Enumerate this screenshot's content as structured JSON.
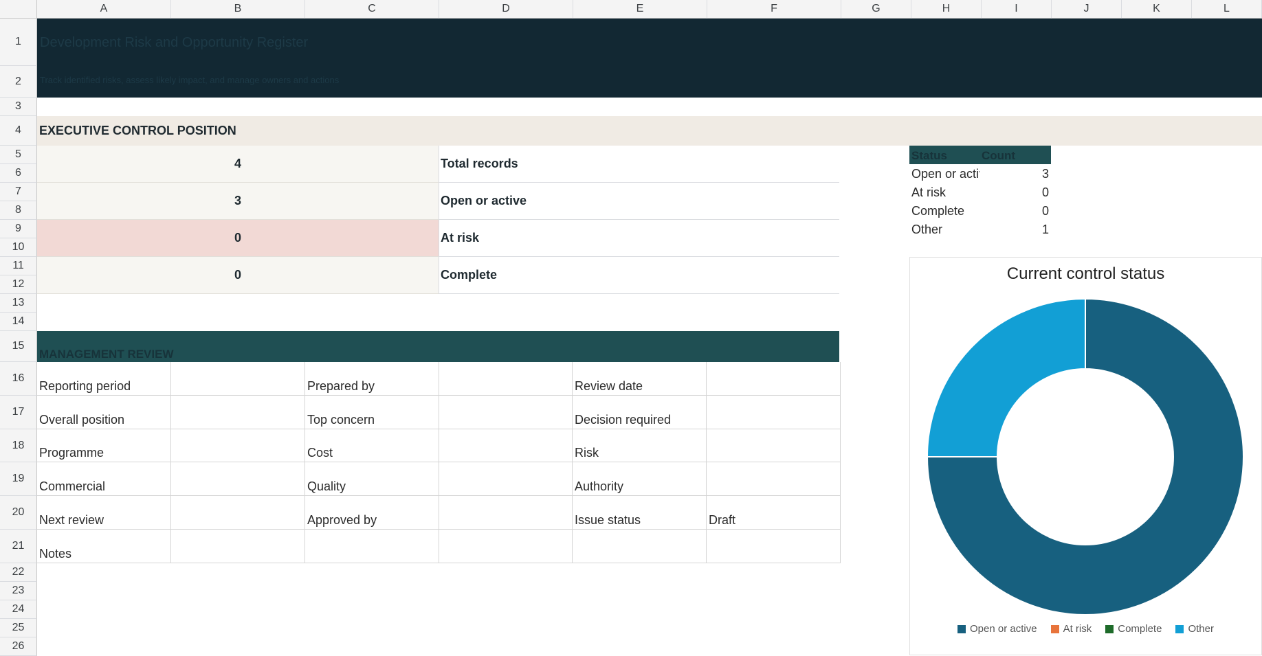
{
  "columns": [
    "A",
    "B",
    "C",
    "D",
    "E",
    "F",
    "G",
    "H",
    "I",
    "J",
    "K",
    "L"
  ],
  "rows": [
    "1",
    "2",
    "3",
    "4",
    "5",
    "6",
    "7",
    "8",
    "9",
    "10",
    "11",
    "12",
    "13",
    "14",
    "15",
    "16",
    "17",
    "18",
    "19",
    "20",
    "21",
    "22",
    "23",
    "24",
    "25",
    "26"
  ],
  "header": {
    "title": "Development Risk and Opportunity Register",
    "subtitle": "Track identified risks, assess likely impact, and manage owners and actions"
  },
  "executive": {
    "heading": "EXECUTIVE CONTROL POSITION",
    "kpis": [
      {
        "value": "4",
        "label": "Total records"
      },
      {
        "value": "3",
        "label": "Open or active"
      },
      {
        "value": "0",
        "label": "At risk"
      },
      {
        "value": "0",
        "label": "Complete"
      }
    ]
  },
  "review": {
    "heading": "MANAGEMENT REVIEW",
    "rows": [
      [
        "Reporting period",
        "",
        "Prepared by",
        "",
        "Review date",
        ""
      ],
      [
        "Overall position",
        "",
        "Top concern",
        "",
        "Decision required",
        ""
      ],
      [
        "Programme",
        "",
        "Cost",
        "",
        "Risk",
        ""
      ],
      [
        "Commercial",
        "",
        "Quality",
        "",
        "Authority",
        ""
      ],
      [
        "Next review",
        "",
        "Approved by",
        "",
        "Issue status",
        "Draft"
      ],
      [
        "Notes",
        "",
        "",
        "",
        "",
        ""
      ]
    ]
  },
  "pivot": {
    "headers": [
      "Status",
      "Count"
    ],
    "rows": [
      {
        "label": "Open or active",
        "count": "3"
      },
      {
        "label": "At risk",
        "count": "0"
      },
      {
        "label": "Complete",
        "count": "0"
      },
      {
        "label": "Other",
        "count": "1"
      }
    ]
  },
  "colors": {
    "open": "#17607f",
    "risk": "#e8743b",
    "complete": "#1e6b2a",
    "other": "#129fd5"
  },
  "chart_data": {
    "type": "pie",
    "title": "Current control status",
    "categories": [
      "Open or active",
      "At risk",
      "Complete",
      "Other"
    ],
    "values": [
      3,
      0,
      0,
      1
    ],
    "colors": [
      "#17607f",
      "#e8743b",
      "#1e6b2a",
      "#129fd5"
    ],
    "donut": true,
    "legend": "bottom"
  }
}
